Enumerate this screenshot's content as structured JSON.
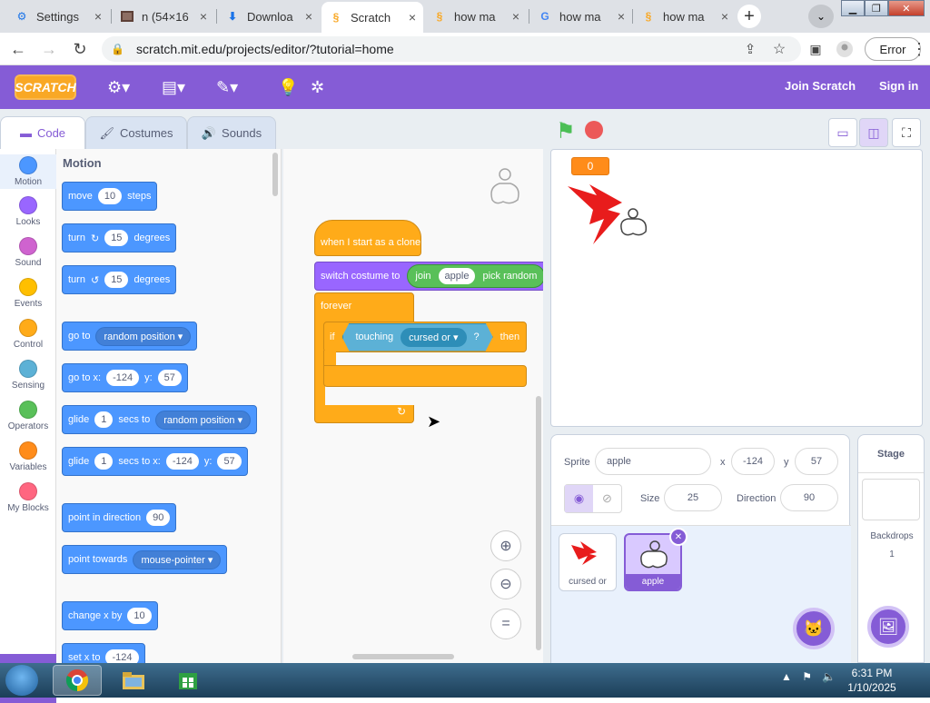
{
  "browser": {
    "tabs": [
      {
        "title": "Settings",
        "icon": "gear-icon",
        "color": "#1a73e8"
      },
      {
        "title": "n (54×16",
        "icon": "image-icon",
        "color": "#5d4037"
      },
      {
        "title": "Downloa",
        "icon": "download-icon",
        "color": "#1a73e8"
      },
      {
        "title": "Scratch",
        "icon": "scratch-icon",
        "color": "#f9a825"
      },
      {
        "title": "how ma",
        "icon": "scratch-icon",
        "color": "#f9a825"
      },
      {
        "title": "how ma",
        "icon": "google-icon",
        "color": "#4285f4"
      },
      {
        "title": "how ma",
        "icon": "scratch-icon",
        "color": "#f9a825"
      }
    ],
    "url": "scratch.mit.edu/projects/editor/?tutorial=home",
    "error_label": "Error"
  },
  "menu": {
    "logo": "SCRATCH",
    "join": "Join Scratch",
    "signin": "Sign in"
  },
  "editor_tabs": {
    "code": "Code",
    "costumes": "Costumes",
    "sounds": "Sounds"
  },
  "categories": [
    {
      "label": "Motion",
      "color": "#4c97ff"
    },
    {
      "label": "Looks",
      "color": "#9966ff"
    },
    {
      "label": "Sound",
      "color": "#cf63cf"
    },
    {
      "label": "Events",
      "color": "#ffbf00"
    },
    {
      "label": "Control",
      "color": "#ffab19"
    },
    {
      "label": "Sensing",
      "color": "#5cb1d6"
    },
    {
      "label": "Operators",
      "color": "#59c059"
    },
    {
      "label": "Variables",
      "color": "#ff8c1a"
    },
    {
      "label": "My Blocks",
      "color": "#ff6680"
    }
  ],
  "palette": {
    "title": "Motion",
    "move": {
      "a": "move",
      "n": "10",
      "b": "steps"
    },
    "turn_right": {
      "a": "turn",
      "n": "15",
      "b": "degrees"
    },
    "turn_left": {
      "a": "turn",
      "n": "15",
      "b": "degrees"
    },
    "goto": {
      "a": "go to",
      "dd": "random position"
    },
    "gotoxy": {
      "a": "go to x:",
      "x": "-124",
      "b": "y:",
      "y": "57"
    },
    "glide": {
      "a": "glide",
      "n": "1",
      "b": "secs to",
      "dd": "random position"
    },
    "glidexy": {
      "a": "glide",
      "n": "1",
      "b": "secs to x:",
      "x": "-124",
      "c": "y:",
      "y": "57"
    },
    "point_dir": {
      "a": "point in direction",
      "n": "90"
    },
    "point_towards": {
      "a": "point towards",
      "dd": "mouse-pointer"
    },
    "change_x": {
      "a": "change x by",
      "n": "10"
    },
    "set_x": {
      "a": "set x to",
      "n": "-124"
    }
  },
  "script": {
    "hat": "when I start as a clone",
    "switch": "switch costume to",
    "join": "join",
    "join_val": "apple",
    "pick": "pick random",
    "forever": "forever",
    "if": "if",
    "touching": "touching",
    "touching_dd": "cursed or",
    "q": "?",
    "then": "then"
  },
  "stage": {
    "var_value": "0"
  },
  "sprite_info": {
    "sprite_label": "Sprite",
    "sprite_name": "apple",
    "x_label": "x",
    "x": "-124",
    "y_label": "y",
    "y": "57",
    "size_label": "Size",
    "size": "25",
    "dir_label": "Direction",
    "direction": "90"
  },
  "sprites": [
    {
      "name": "cursed or"
    },
    {
      "name": "apple"
    }
  ],
  "stage_pane": {
    "title": "Stage",
    "backdrops_label": "Backdrops",
    "backdrops_count": "1"
  },
  "taskbar": {
    "time": "6:31 PM",
    "date": "1/10/2025"
  }
}
